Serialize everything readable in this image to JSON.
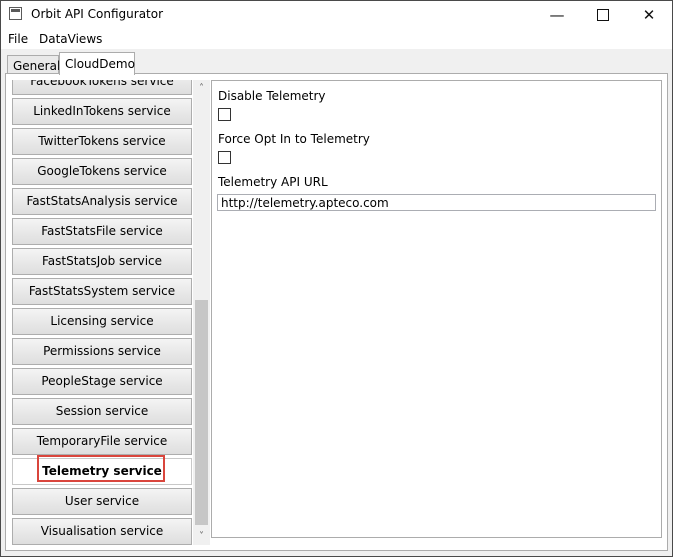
{
  "window": {
    "title": "Orbit API Configurator",
    "controls": {
      "minimize": "—",
      "maximize": "",
      "close": "✕"
    }
  },
  "menu": {
    "items": [
      "File",
      "DataViews"
    ]
  },
  "tabs": [
    {
      "label": "General",
      "active": false
    },
    {
      "label": "CloudDemo",
      "active": true
    }
  ],
  "services": [
    {
      "label": "FacebookTokens service",
      "selected": false
    },
    {
      "label": "LinkedInTokens service",
      "selected": false
    },
    {
      "label": "TwitterTokens service",
      "selected": false
    },
    {
      "label": "GoogleTokens service",
      "selected": false
    },
    {
      "label": "FastStatsAnalysis service",
      "selected": false
    },
    {
      "label": "FastStatsFile service",
      "selected": false
    },
    {
      "label": "FastStatsJob service",
      "selected": false
    },
    {
      "label": "FastStatsSystem service",
      "selected": false
    },
    {
      "label": "Licensing service",
      "selected": false
    },
    {
      "label": "Permissions service",
      "selected": false
    },
    {
      "label": "PeopleStage service",
      "selected": false
    },
    {
      "label": "Session service",
      "selected": false
    },
    {
      "label": "TemporaryFile service",
      "selected": false
    },
    {
      "label": "Telemetry service",
      "selected": true
    },
    {
      "label": "User service",
      "selected": false
    },
    {
      "label": "Visualisation service",
      "selected": false
    }
  ],
  "scrollbar": {
    "up_icon": "˄",
    "down_icon": "˅"
  },
  "settings": {
    "disable_telemetry_label": "Disable Telemetry",
    "disable_telemetry_checked": false,
    "force_opt_in_label": "Force Opt In to Telemetry",
    "force_opt_in_checked": false,
    "api_url_label": "Telemetry API URL",
    "api_url_value": "http://telemetry.apteco.com"
  },
  "colors": {
    "highlight": "#d9453c"
  }
}
